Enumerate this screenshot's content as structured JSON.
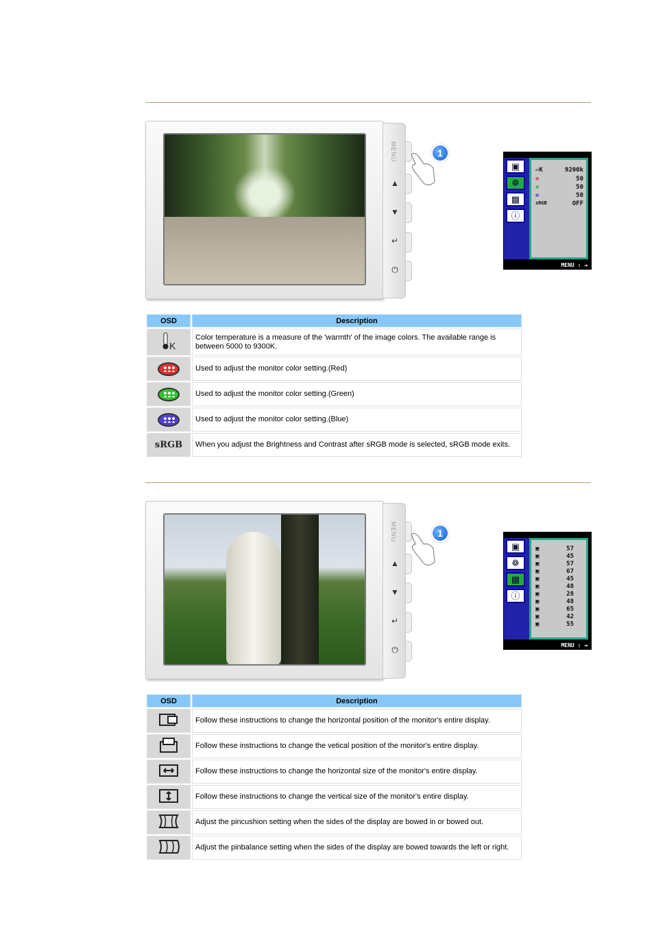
{
  "section1": {
    "osd_menu": {
      "icons": [
        "picture-icon",
        "color-icon",
        "geometry-icon",
        "info-icon"
      ],
      "selected": 1,
      "rows": [
        {
          "icon": "temperature-icon",
          "glyph": "🌡K",
          "value": "9200k"
        },
        {
          "icon": "red-palette-icon",
          "glyph": "❁",
          "value": "50"
        },
        {
          "icon": "green-palette-icon",
          "glyph": "❁",
          "value": "50"
        },
        {
          "icon": "blue-palette-icon",
          "glyph": "❁",
          "value": "50"
        },
        {
          "icon": "srgb-icon",
          "glyph": "sRGB",
          "value": "OFF"
        }
      ],
      "footer": "MENU : ⇥"
    },
    "table": {
      "header_osd": "OSD",
      "header_desc": "Description",
      "rows": [
        {
          "icon": "color-temperature-icon",
          "desc": "Color temperature is a measure of the 'warmth' of the image colors. The available range is between 5000 to 9300K."
        },
        {
          "icon": "red-palette-icon",
          "color": "#e03030",
          "desc": "Used to adjust the monitor color setting.(Red)"
        },
        {
          "icon": "green-palette-icon",
          "color": "#30c030",
          "desc": "Used to adjust the monitor color setting.(Green)"
        },
        {
          "icon": "blue-palette-icon",
          "color": "#5040d0",
          "desc": "Used to adjust the monitor color setting.(Blue)"
        },
        {
          "icon": "srgb-icon",
          "label": "sRGB",
          "desc": "When you adjust the Brightness and Contrast after sRGB mode is selected, sRGB mode exits."
        }
      ]
    }
  },
  "section2": {
    "osd_menu": {
      "selected": 2,
      "values": [
        "57",
        "45",
        "57",
        "67",
        "45",
        "48",
        "28",
        "48",
        "65",
        "42",
        "55"
      ],
      "footer": "MENU : ⇥"
    },
    "table": {
      "header_osd": "OSD",
      "header_desc": "Description",
      "rows": [
        {
          "icon": "horizontal-position-icon",
          "desc": "Follow these instructions to change the horizontal position of the monitor's entire display."
        },
        {
          "icon": "vertical-position-icon",
          "desc": "Follow these instructions to change the vetical position of the monitor's entire display."
        },
        {
          "icon": "horizontal-size-icon",
          "desc": "Follow these instructions to change the horizontal size of the monitor's entire display."
        },
        {
          "icon": "vertical-size-icon",
          "desc": "Follow these instructions to change the vertical size of the monitor's entire display."
        },
        {
          "icon": "pincushion-icon",
          "desc": "Adjust the pincushion setting when the sides of the display are bowed in or bowed out."
        },
        {
          "icon": "pinbalance-icon",
          "desc": "Adjust the pinbalance setting when the sides of the display are bowed towards the left or right."
        }
      ]
    }
  },
  "monitor": {
    "menu_label": "MENU",
    "step_badge": "1",
    "buttons": [
      "▲",
      "▼",
      "↵",
      "⏻"
    ]
  }
}
